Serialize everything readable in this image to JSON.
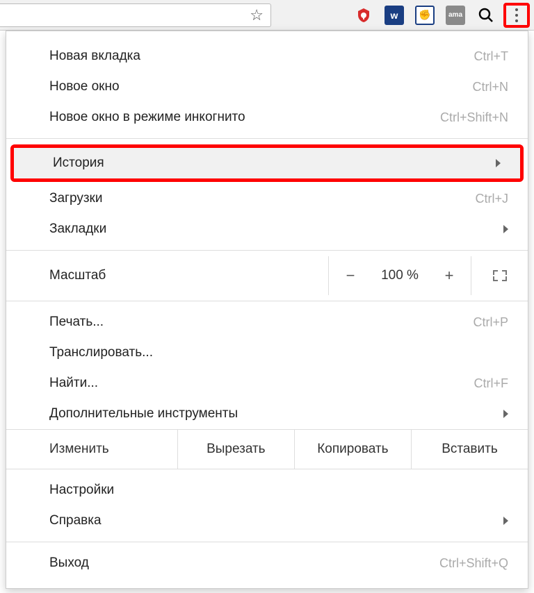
{
  "menu": {
    "new_tab": {
      "label": "Новая вкладка",
      "shortcut": "Ctrl+T"
    },
    "new_window": {
      "label": "Новое окно",
      "shortcut": "Ctrl+N"
    },
    "incognito": {
      "label": "Новое окно в режиме инкогнито",
      "shortcut": "Ctrl+Shift+N"
    },
    "history": {
      "label": "История"
    },
    "downloads": {
      "label": "Загрузки",
      "shortcut": "Ctrl+J"
    },
    "bookmarks": {
      "label": "Закладки"
    },
    "zoom": {
      "label": "Масштаб",
      "value": "100 %",
      "minus": "−",
      "plus": "+"
    },
    "print": {
      "label": "Печать...",
      "shortcut": "Ctrl+P"
    },
    "cast": {
      "label": "Транслировать..."
    },
    "find": {
      "label": "Найти...",
      "shortcut": "Ctrl+F"
    },
    "more_tools": {
      "label": "Дополнительные инструменты"
    },
    "edit": {
      "label": "Изменить",
      "cut": "Вырезать",
      "copy": "Копировать",
      "paste": "Вставить"
    },
    "settings": {
      "label": "Настройки"
    },
    "help": {
      "label": "Справка"
    },
    "exit": {
      "label": "Выход",
      "shortcut": "Ctrl+Shift+Q"
    }
  }
}
